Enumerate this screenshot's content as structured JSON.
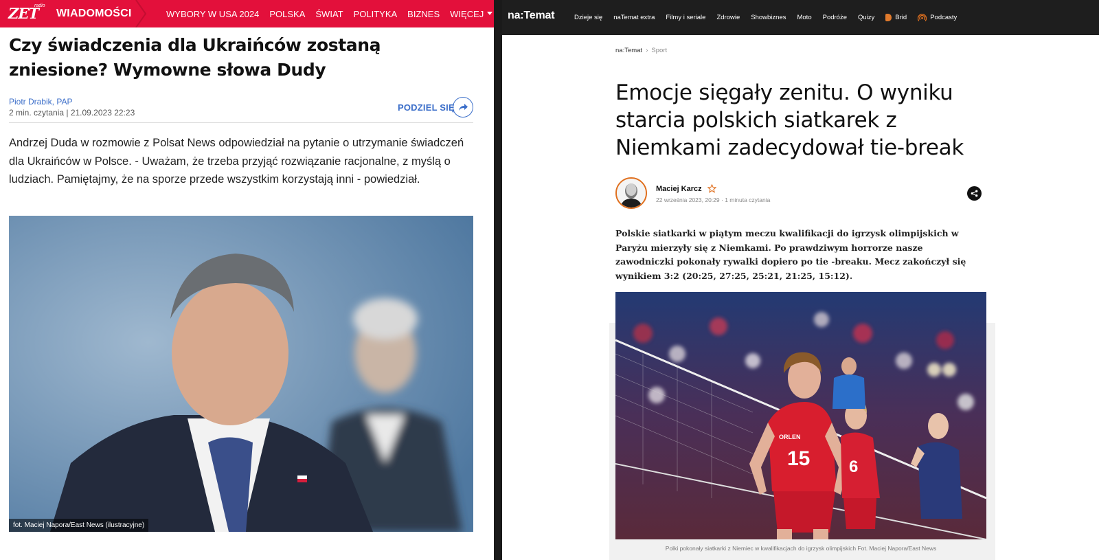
{
  "left": {
    "logo": {
      "word": "ZET",
      "radio": "radio"
    },
    "section": "WIADOMOŚCI",
    "menu": [
      "WYBORY W USA 2024",
      "POLSKA",
      "ŚWIAT",
      "POLITYKA",
      "BIZNES",
      "WIĘCEJ"
    ],
    "title": "Czy świadczenia dla Ukraińców zostaną zniesione? Wymowne słowa Dudy",
    "author": "Piotr Drabik, PAP",
    "meta": "2 min. czytania | 21.09.2023 22:23",
    "share_label": "PODZIEL SIĘ",
    "lead": "Andrzej Duda w rozmowie z Polsat News odpowiedział na pytanie o utrzymanie świadczeń dla Ukraińców w Polsce. - Uważam, że trzeba przyjąć rozwiązanie racjonalne, z myślą o ludziach. Pamiętajmy, że na sporze przede wszystkim korzystają inni - powiedział.",
    "photo_caption": "fot. Maciej Napora/East News (ilustracyjne)",
    "colors": {
      "brand": "#e3103b",
      "link": "#3b6ec9"
    }
  },
  "right": {
    "logo": "na:Temat",
    "menu": [
      "Dzieje się",
      "naTemat extra",
      "Filmy i seriale",
      "Zdrowie",
      "Showbiznes",
      "Moto",
      "Podróże",
      "Quizy",
      "Brid",
      "Podcasty"
    ],
    "breadcrumb": {
      "home": "na:Temat",
      "section": "Sport"
    },
    "title": "Emocje sięgały zenitu. O wyniku starcia polskich siatkarek z Niemkami zadecydował tie-break",
    "author": "Maciej Karcz",
    "date": "22 września 2023, 20:29",
    "reading_time": "1 minuta czytania",
    "lead": "Polskie siatkarki w piątym meczu kwalifikacji do igrzysk olimpijskich w Paryżu mierzyły się z Niemkami. Po prawdziwym horrorze nasze zawodniczki pokonały rywalki dopiero po tie -breaku. Mecz zakończył się wynikiem 3:2 (20:25, 27:25, 25:21, 21:25, 15:12).",
    "photo_caption": "Polki pokonały siatkarki z Niemiec w kwalifikacjach do igrzysk olimpijskich Fot. Maciej Napora/East News",
    "jersey_number_main": "15",
    "jersey_number_second": "6",
    "jersey_sponsor": "ORLEN",
    "colors": {
      "nav": "#1e1e1e",
      "accent": "#e0701f"
    }
  }
}
